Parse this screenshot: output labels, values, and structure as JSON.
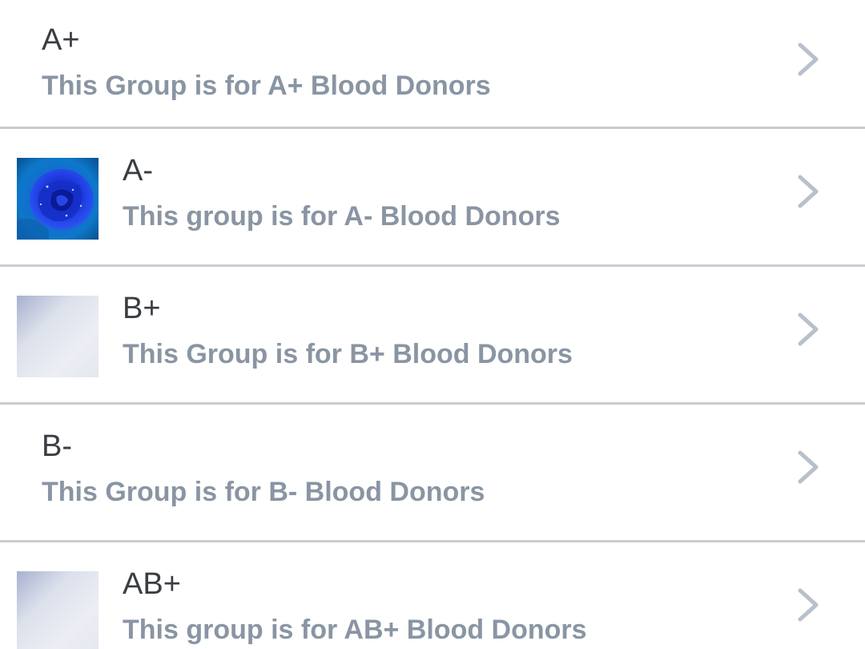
{
  "groups": [
    {
      "title": "A+",
      "subtitle": "This Group is for A+ Blood Donors",
      "thumbnail": "none",
      "chevron_icon": "chevron-right-icon"
    },
    {
      "title": "A-",
      "subtitle": "This group is for A- Blood Donors",
      "thumbnail": "blue-rose-photo",
      "chevron_icon": "chevron-right-icon"
    },
    {
      "title": "B+",
      "subtitle": "This Group is for B+ Blood Donors",
      "thumbnail": "placeholder-gradient",
      "chevron_icon": "chevron-right-icon"
    },
    {
      "title": "B-",
      "subtitle": "This Group is for B- Blood Donors",
      "thumbnail": "none",
      "chevron_icon": "chevron-right-icon"
    },
    {
      "title": "AB+",
      "subtitle": "This group is for AB+ Blood Donors",
      "thumbnail": "placeholder-gradient",
      "chevron_icon": "chevron-right-icon"
    }
  ],
  "colors": {
    "title": "#3a3d42",
    "subtitle": "#8a95a3",
    "divider": "#c8cdd3",
    "chevron": "#b8c0cb",
    "background": "#ffffff"
  }
}
